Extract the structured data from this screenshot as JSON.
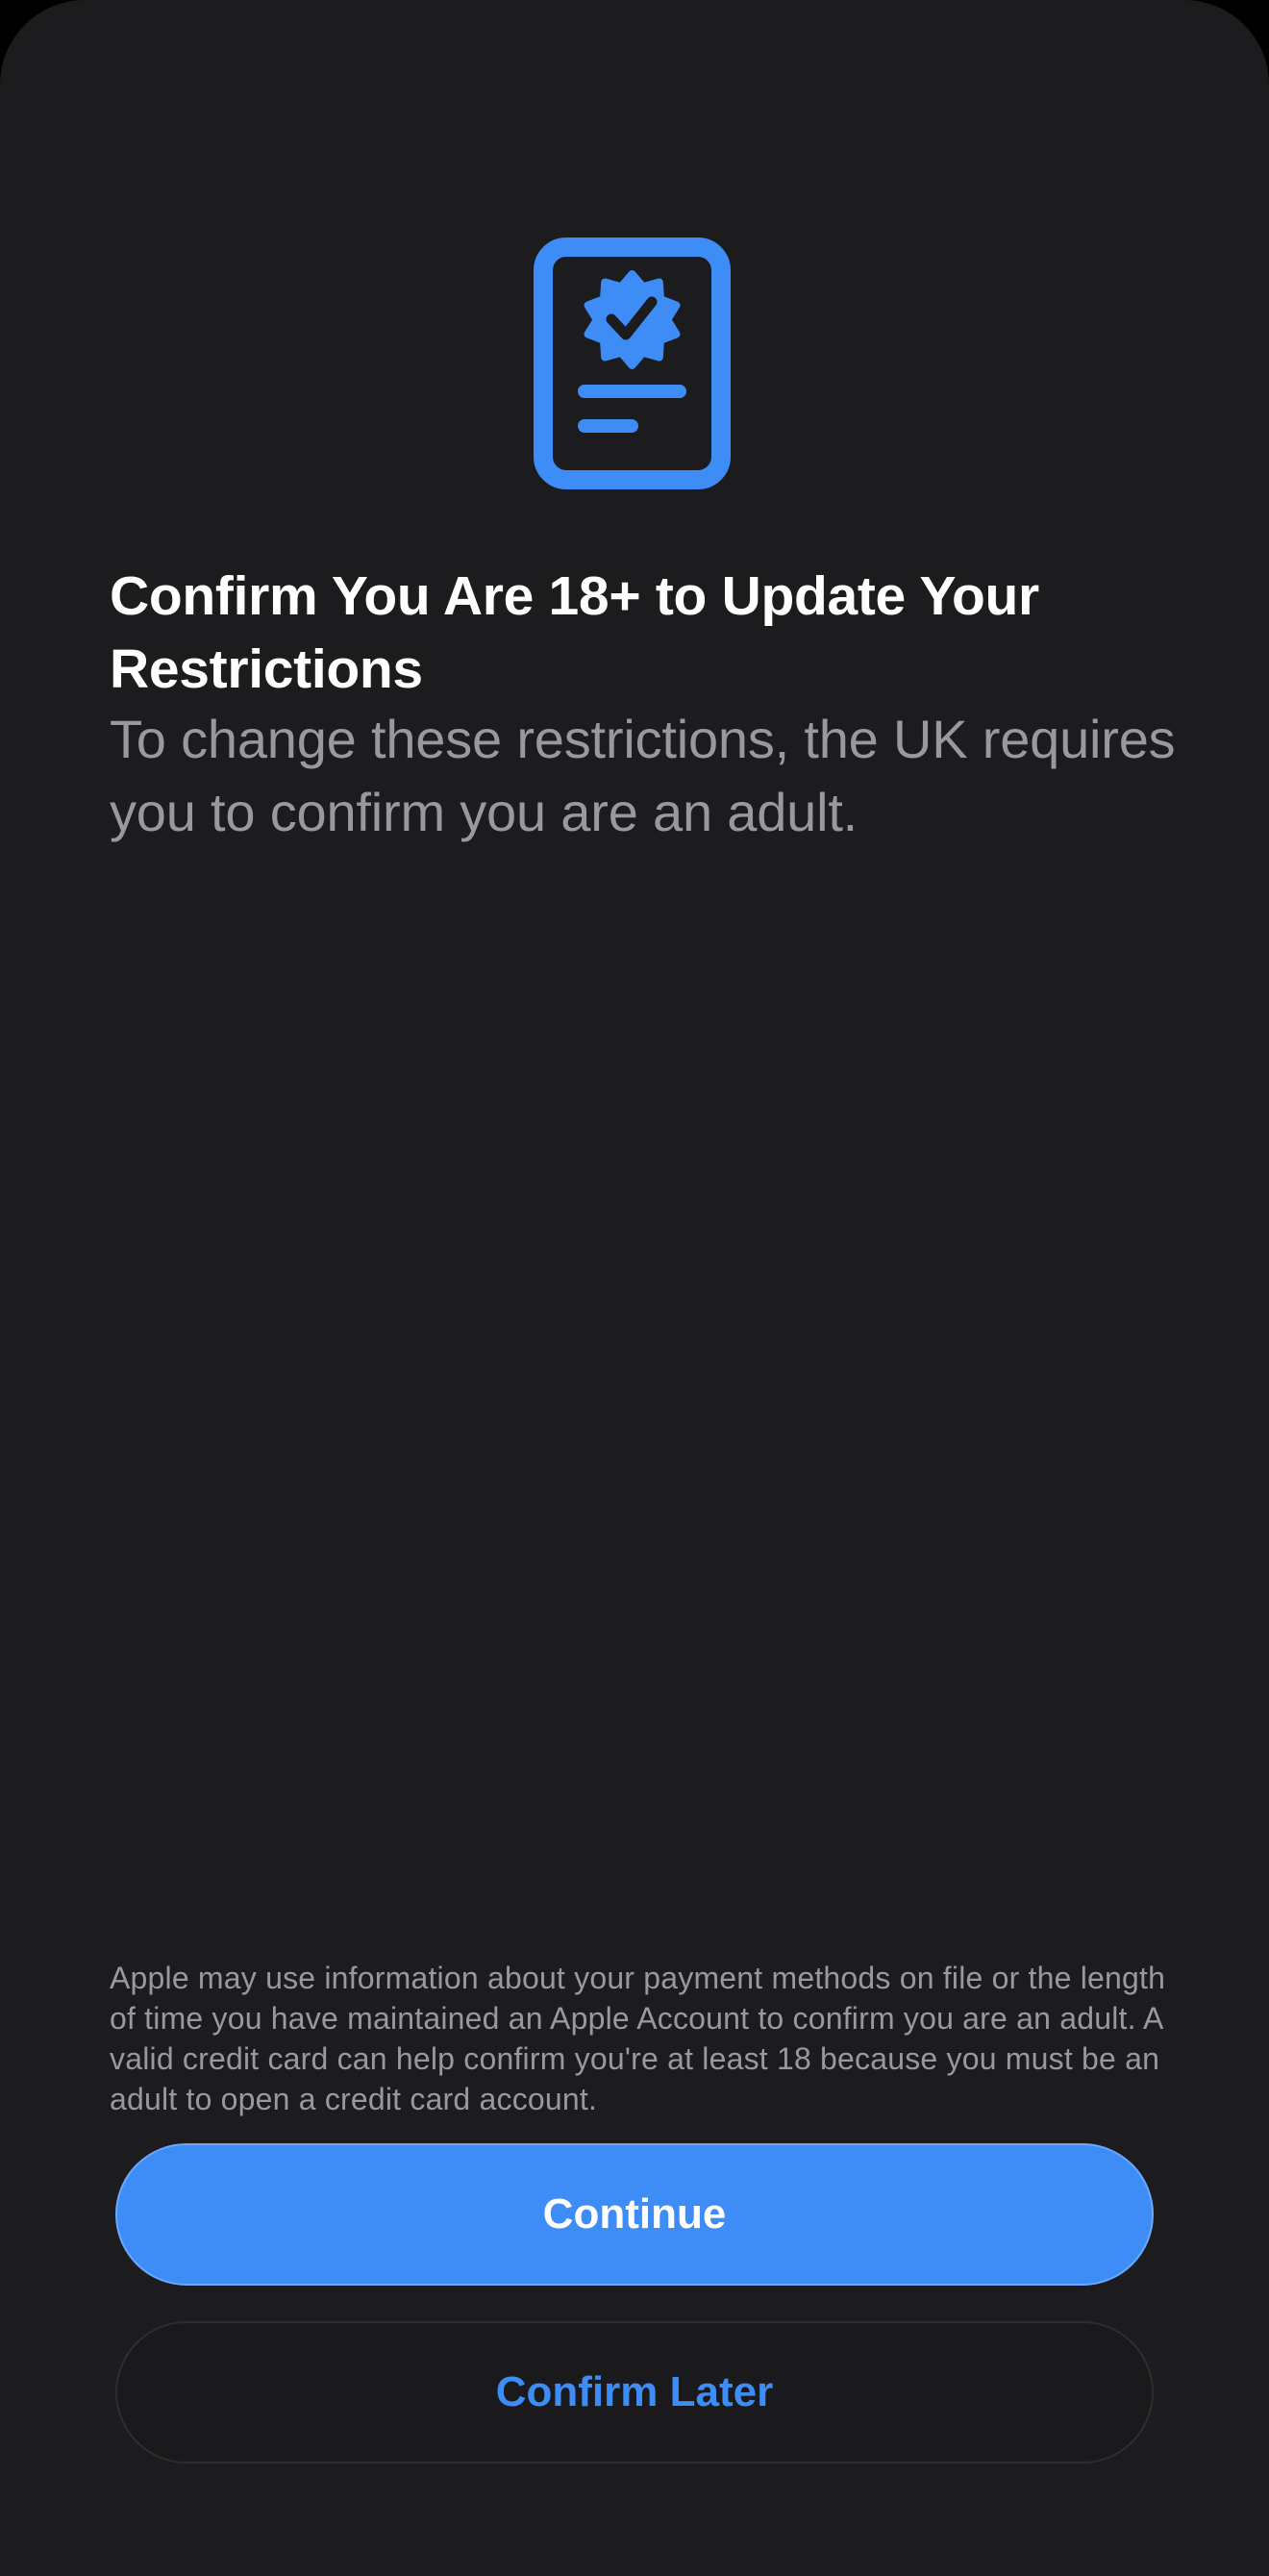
{
  "sheet": {
    "icon": "verified-document-icon",
    "title": "Confirm You Are 18+ to Update Your Restrictions",
    "subtitle": "To change these restrictions, the UK requires you to confirm you are an adult.",
    "disclaimer": "Apple may use information about your payment methods on file or the length of time you have maintained an Apple Account to confirm you are an adult. A valid credit card can help confirm you're at least 18 because you must be an adult to open a credit card account."
  },
  "actions": {
    "continue_label": "Continue",
    "confirm_later_label": "Confirm Later"
  },
  "colors": {
    "background": "#1c1c1e",
    "accent": "#3e8cf6",
    "secondary_text": "#98989f"
  }
}
